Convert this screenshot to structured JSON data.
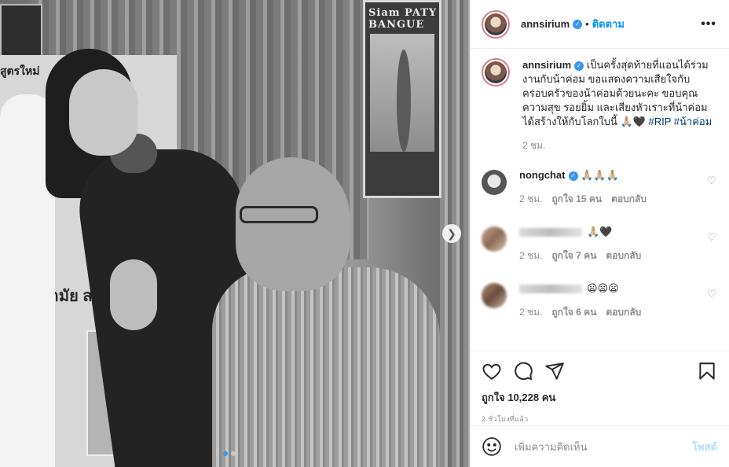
{
  "post": {
    "username": "annsirium",
    "follow_label": "ติดตาม",
    "dot": "•",
    "more_label": "•••",
    "caption_text": "เป็นครั้งสุดท้ายที่แอนได้ร่วมงานกับน้าค่อม ขอแสดงความเสียใจกับครอบครัวของน้าค่อมด้วยนะคะ ขอบคุณความสุข รอยยิ้ม และเสียงหัวเราะที่น้าค่อมได้สร้างให้กับโลกใบนี้ 🙏🏼🖤 ",
    "caption_tags": "#RIP #น้าค่อม",
    "caption_age": "2 ชม."
  },
  "comments": [
    {
      "username": "nongchat",
      "text": "🙏🏼🙏🏼🙏🏼",
      "age": "2 ชม.",
      "likes": "ถูกใจ 15 คน",
      "reply": "ตอบกลับ"
    },
    {
      "username": "",
      "text": "🙏🏼🖤",
      "age": "2 ชม.",
      "likes": "ถูกใจ 7 คน",
      "reply": "ตอบกลับ"
    },
    {
      "username": "",
      "text": "😦😦😦",
      "age": "2 ชม.",
      "likes": "ถูกใจ 6 คน",
      "reply": "ตอบกลับ"
    }
  ],
  "actions": {
    "likes_label": "ถูกใจ 10,228 คน",
    "timestamp": "2 ชั่วโมงที่แล้ว"
  },
  "add_comment": {
    "placeholder": "เพิ่มความคิดเห็น",
    "post_label": "โพสต์"
  },
  "photo": {
    "next_icon": "chevron-right-icon",
    "carousel_pages": 2,
    "current_page": 1,
    "poster_text": "Siam PATY BANGUE",
    "banner_text_top": "สูตรใหม่",
    "banner_text_mid": "นามัย สะอาด"
  },
  "colors": {
    "link": "#0095f6",
    "hashtag": "#00376b",
    "verified": "#3897f0",
    "muted": "#8e8e8e"
  }
}
